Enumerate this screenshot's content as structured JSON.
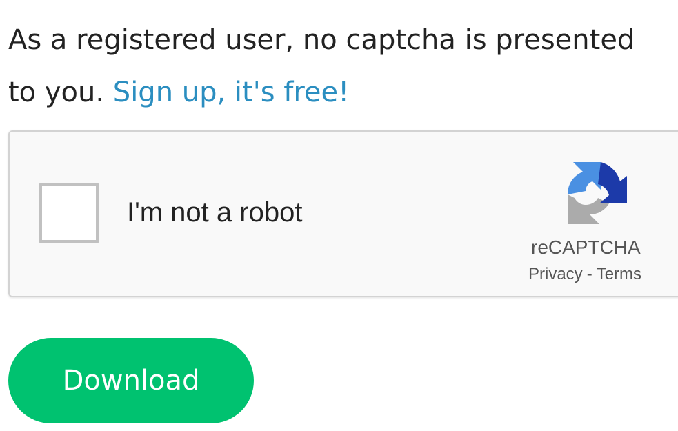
{
  "notice": {
    "text": "As a registered user, no captcha is presented to you. ",
    "signup_link": "Sign up, it's free!"
  },
  "captcha": {
    "label": "I'm not a robot",
    "brand": "reCAPTCHA",
    "privacy_link": "Privacy",
    "separator": "-",
    "terms_link": "Terms",
    "checked": false,
    "logo_icon": "recaptcha-logo-icon"
  },
  "download": {
    "label": "Download"
  },
  "colors": {
    "link": "#2b8ec0",
    "download_button": "#00c270",
    "captcha_background": "#f9f9f9",
    "recaptcha_blue": "#4a90e2",
    "recaptcha_dark_blue": "#1c3aa9",
    "recaptcha_gray": "#ababab"
  }
}
